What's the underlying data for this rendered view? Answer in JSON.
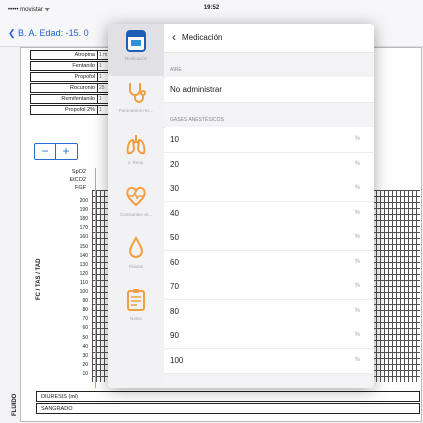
{
  "status": {
    "carrier": "••••• movistar ᯤ",
    "time": "19:52"
  },
  "nav": {
    "back_label": "B. A. Edad: -15. 0"
  },
  "drugs": [
    {
      "name": "Atropina",
      "val": "1 m"
    },
    {
      "name": "Fentanilo",
      "val": "1"
    },
    {
      "name": "Propofol",
      "val": "1"
    },
    {
      "name": "Rocuronio",
      "val": "25"
    },
    {
      "name": "Remifentanilo",
      "val": "1"
    },
    {
      "name": "Propofol 2%",
      "val": "1"
    }
  ],
  "stepper": {
    "minus": "−",
    "plus": "+"
  },
  "vitals": {
    "spo2": "SpO2",
    "etco2": "EtCO2",
    "fgf": "FGF"
  },
  "scale": [
    "200",
    "190",
    "180",
    "170",
    "160",
    "150",
    "140",
    "130",
    "120",
    "110",
    "100",
    "90",
    "80",
    "70",
    "60",
    "50",
    "40",
    "30",
    "20",
    "10"
  ],
  "axis": {
    "fc_label": "FC / TAS / TAD",
    "fluido_label": "FLUIDO"
  },
  "bottom": {
    "diuresis": "DIURESIS (ml)",
    "sangrado": "SANGRADO"
  },
  "side_items": [
    {
      "label": "Medicación",
      "icon": "medication-icon"
    },
    {
      "label": "Parámetros res...",
      "icon": "stethoscope-icon"
    },
    {
      "label": "V. Resp.",
      "icon": "lungs-icon"
    },
    {
      "label": "Constantes vit...",
      "icon": "heart-pulse-icon"
    },
    {
      "label": "Fluidos",
      "icon": "drop-icon"
    },
    {
      "label": "Notas",
      "icon": "notes-icon"
    }
  ],
  "panel": {
    "title": "Medicación",
    "section_aire": "AIRE",
    "aire_value": "No administrar",
    "section_gases": "GASES ANESTÉSICOS",
    "unit": "%",
    "gases": [
      "10",
      "20",
      "30",
      "40",
      "50",
      "60",
      "70",
      "80",
      "90",
      "100"
    ]
  },
  "colors": {
    "accent": "#2a6bd1",
    "back": "#1e62c9",
    "icon_orange": "#f0a042"
  }
}
